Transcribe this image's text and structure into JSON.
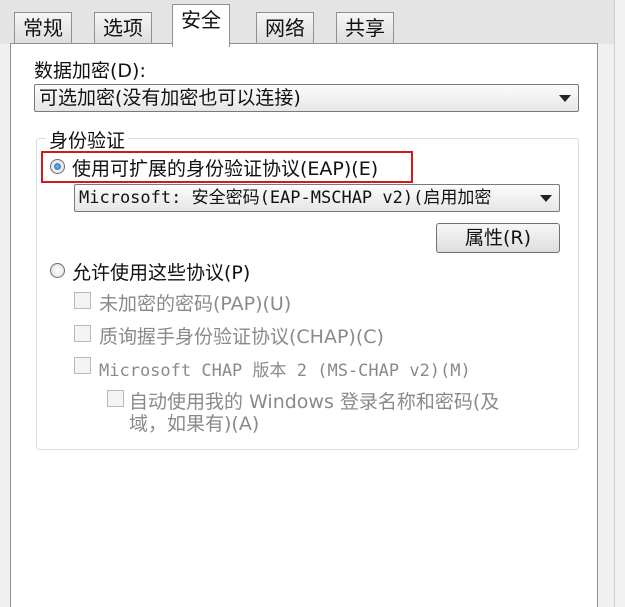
{
  "tabs": [
    {
      "label": "常规"
    },
    {
      "label": "选项"
    },
    {
      "label": "安全"
    },
    {
      "label": "网络"
    },
    {
      "label": "共享"
    }
  ],
  "active_tab": "安全",
  "encryption": {
    "label": "数据加密(D):",
    "selected": "可选加密(没有加密也可以连接)"
  },
  "auth": {
    "group_label": "身份验证",
    "eap_radio": {
      "label": "使用可扩展的身份验证协议(EAP)(E)",
      "checked": true
    },
    "eap_method": "Microsoft: 安全密码(EAP-MSCHAP v2)(启用加密",
    "properties_button": "属性(R)",
    "allow_radio": {
      "label": "允许使用这些协议(P)",
      "checked": false
    },
    "protocols": [
      {
        "label": "未加密的密码(PAP)(U)"
      },
      {
        "label": "质询握手身份验证协议(CHAP)(C)"
      },
      {
        "label": "Microsoft CHAP 版本 2 (MS-CHAP v2)(M)"
      }
    ],
    "auto_windows_line1": "自动使用我的 Windows 登录名称和密码(及",
    "auto_windows_line2": "域，如果有)(A)"
  },
  "colors": {
    "highlight": "#d21a1a",
    "radio_dot": "#1a5fb4"
  }
}
